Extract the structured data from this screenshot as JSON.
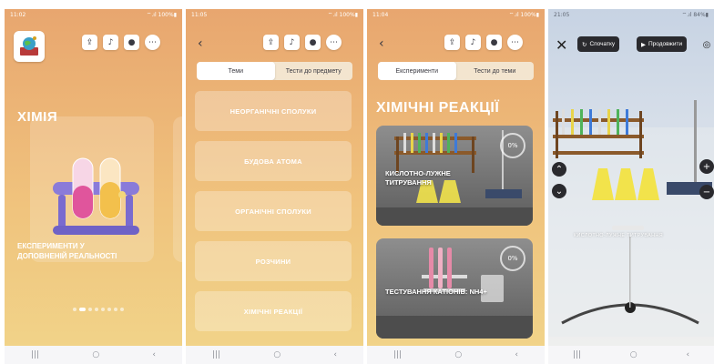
{
  "status_bars": [
    {
      "time": "11:02",
      "icons": "✉ ◎ ▣ •",
      "right": "⌔.ıl 100%▮"
    },
    {
      "time": "11:05",
      "icons": "▣ ◎ ◎ •",
      "right": "⌔.ıl 100%▮"
    },
    {
      "time": "11:04",
      "icons": "▣ ◎ ◎ •",
      "right": "⌔.ıl 100%▮"
    },
    {
      "time": "21:05",
      "icons": "◎ ▣",
      "right": "⌔.ıl 84%▮"
    }
  ],
  "nav_buttons": {
    "recent": "|||",
    "home": "○",
    "back": "‹"
  },
  "toolbar_icons": [
    "share-icon",
    "bell-icon",
    "user-icon",
    "more-icon"
  ],
  "screen1": {
    "title": "ХІМІЯ",
    "card_text": "ЕКСПЕРИМЕНТИ У ДОПОВНЕНІЙ РЕАЛЬНОСТІ",
    "carousel_pages": 8,
    "carousel_active": 1
  },
  "screen2": {
    "tabs": [
      {
        "label": "Теми",
        "active": true
      },
      {
        "label": "Тести до предмету",
        "active": false
      }
    ],
    "topics": [
      "НЕОРГАНІЧНІ СПОЛУКИ",
      "БУДОВА АТОМА",
      "ОРГАНІЧНІ СПОЛУКИ",
      "РОЗЧИНИ",
      "ХІМІЧНІ РЕАКЦІЇ"
    ]
  },
  "screen3": {
    "tabs": [
      {
        "label": "Експерименти",
        "active": true
      },
      {
        "label": "Тести до теми",
        "active": false
      }
    ],
    "title": "ХІМІЧНІ РЕАКЦІЇ",
    "experiments": [
      {
        "label": "КИСЛОТНО-ЛУЖНЕ ТИТРУВАННЯ",
        "progress": "0%"
      },
      {
        "label": "ТЕСТУВАННЯ КАТІОНІВ: NH4+",
        "progress": "0%"
      }
    ]
  },
  "screen4": {
    "restart_label": "Спочатку",
    "continue_label": "Продовжити",
    "scene_caption": "КИСЛОТНО-ЛУЖНЕ ТИТРУВАННЯ"
  },
  "colors": {
    "gradient_top": "#e8a66f",
    "gradient_bottom": "#f1d58a",
    "dark_button": "#2a2a2e"
  }
}
